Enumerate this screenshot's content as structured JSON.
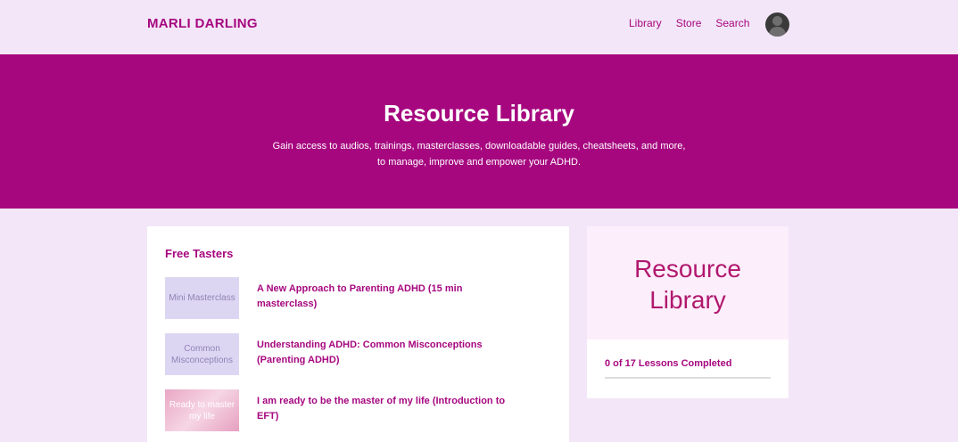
{
  "header": {
    "brand": "MARLI DARLING",
    "nav": [
      "Library",
      "Store",
      "Search"
    ]
  },
  "hero": {
    "title": "Resource Library",
    "subtitle_line1": "Gain access to audios, trainings, masterclasses, downloadable guides, cheatsheets, and more,",
    "subtitle_line2": "to manage, improve and empower your ADHD."
  },
  "main": {
    "section_title": "Free Tasters",
    "lessons": [
      {
        "thumb": "Mini Masterclass",
        "title": "A New Approach to Parenting ADHD (15 min masterclass)"
      },
      {
        "thumb": "Common Misconceptions",
        "title": "Understanding ADHD: Common Misconceptions (Parenting ADHD)"
      },
      {
        "thumb": "Ready to master my life",
        "title": "I am ready to be the master of my life (Introduction to EFT)"
      }
    ]
  },
  "sidebar": {
    "title": "Resource Library",
    "progress_text": "0 of 17 Lessons Completed",
    "progress_fraction": 0
  },
  "colors": {
    "brand": "#a6077f",
    "background": "#f3e6f8"
  }
}
